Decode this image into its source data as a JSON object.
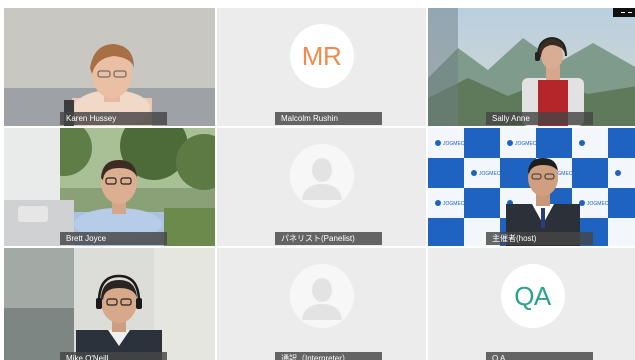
{
  "participants": [
    {
      "name": "Karen Hussey"
    },
    {
      "name": "Malcolm Rushin",
      "initials": "MR",
      "initials_color": "#f28a4c"
    },
    {
      "name": "Sally Anne"
    },
    {
      "name": "Brett Joyce"
    },
    {
      "name": "パネリスト(Panelist)"
    },
    {
      "name": "主催者(host)",
      "banner_text": "JOGMEC"
    },
    {
      "name": "Mike O'Neill"
    },
    {
      "name": "通訳（Interpreter）"
    },
    {
      "name": "Q A",
      "initials": "QA",
      "initials_color": "#2aa28c"
    }
  ]
}
